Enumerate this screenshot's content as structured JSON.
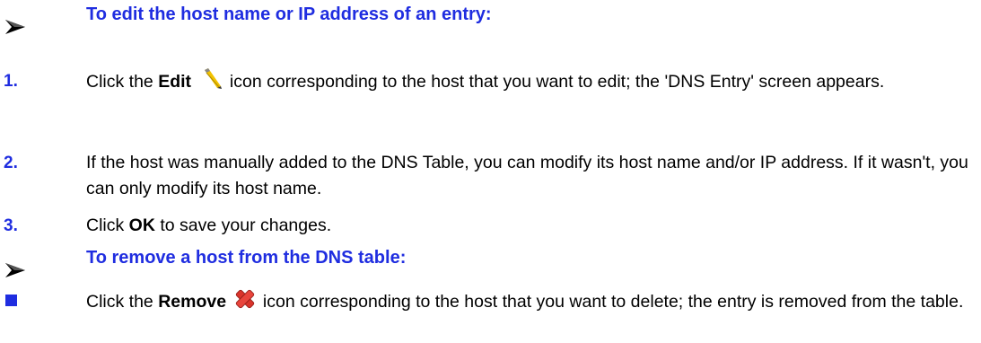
{
  "edit_section": {
    "heading": "To edit the host name or IP address of an entry:",
    "steps": [
      {
        "number": "1.",
        "pre": "Click the ",
        "bold": "Edit",
        "icon": "pencil-edit-icon",
        "post": " icon corresponding to the host that you want to edit; the 'DNS Entry' screen appears."
      },
      {
        "number": "2.",
        "text": "If the host was manually added to the DNS Table, you can modify its host name and/or IP address. If it wasn't, you can only modify its host name."
      },
      {
        "number": "3.",
        "pre": "Click ",
        "bold": "OK",
        "post": " to save your changes."
      }
    ]
  },
  "remove_section": {
    "heading": "To remove a host from the DNS table:",
    "item": {
      "pre": "Click the ",
      "bold": "Remove",
      "icon": "red-x-remove-icon",
      "post": " icon corresponding to the host that you want to delete; the entry is removed from the table."
    }
  },
  "colors": {
    "heading": "#1f2de0",
    "text": "#000000",
    "remove_icon": "#d9342b"
  }
}
